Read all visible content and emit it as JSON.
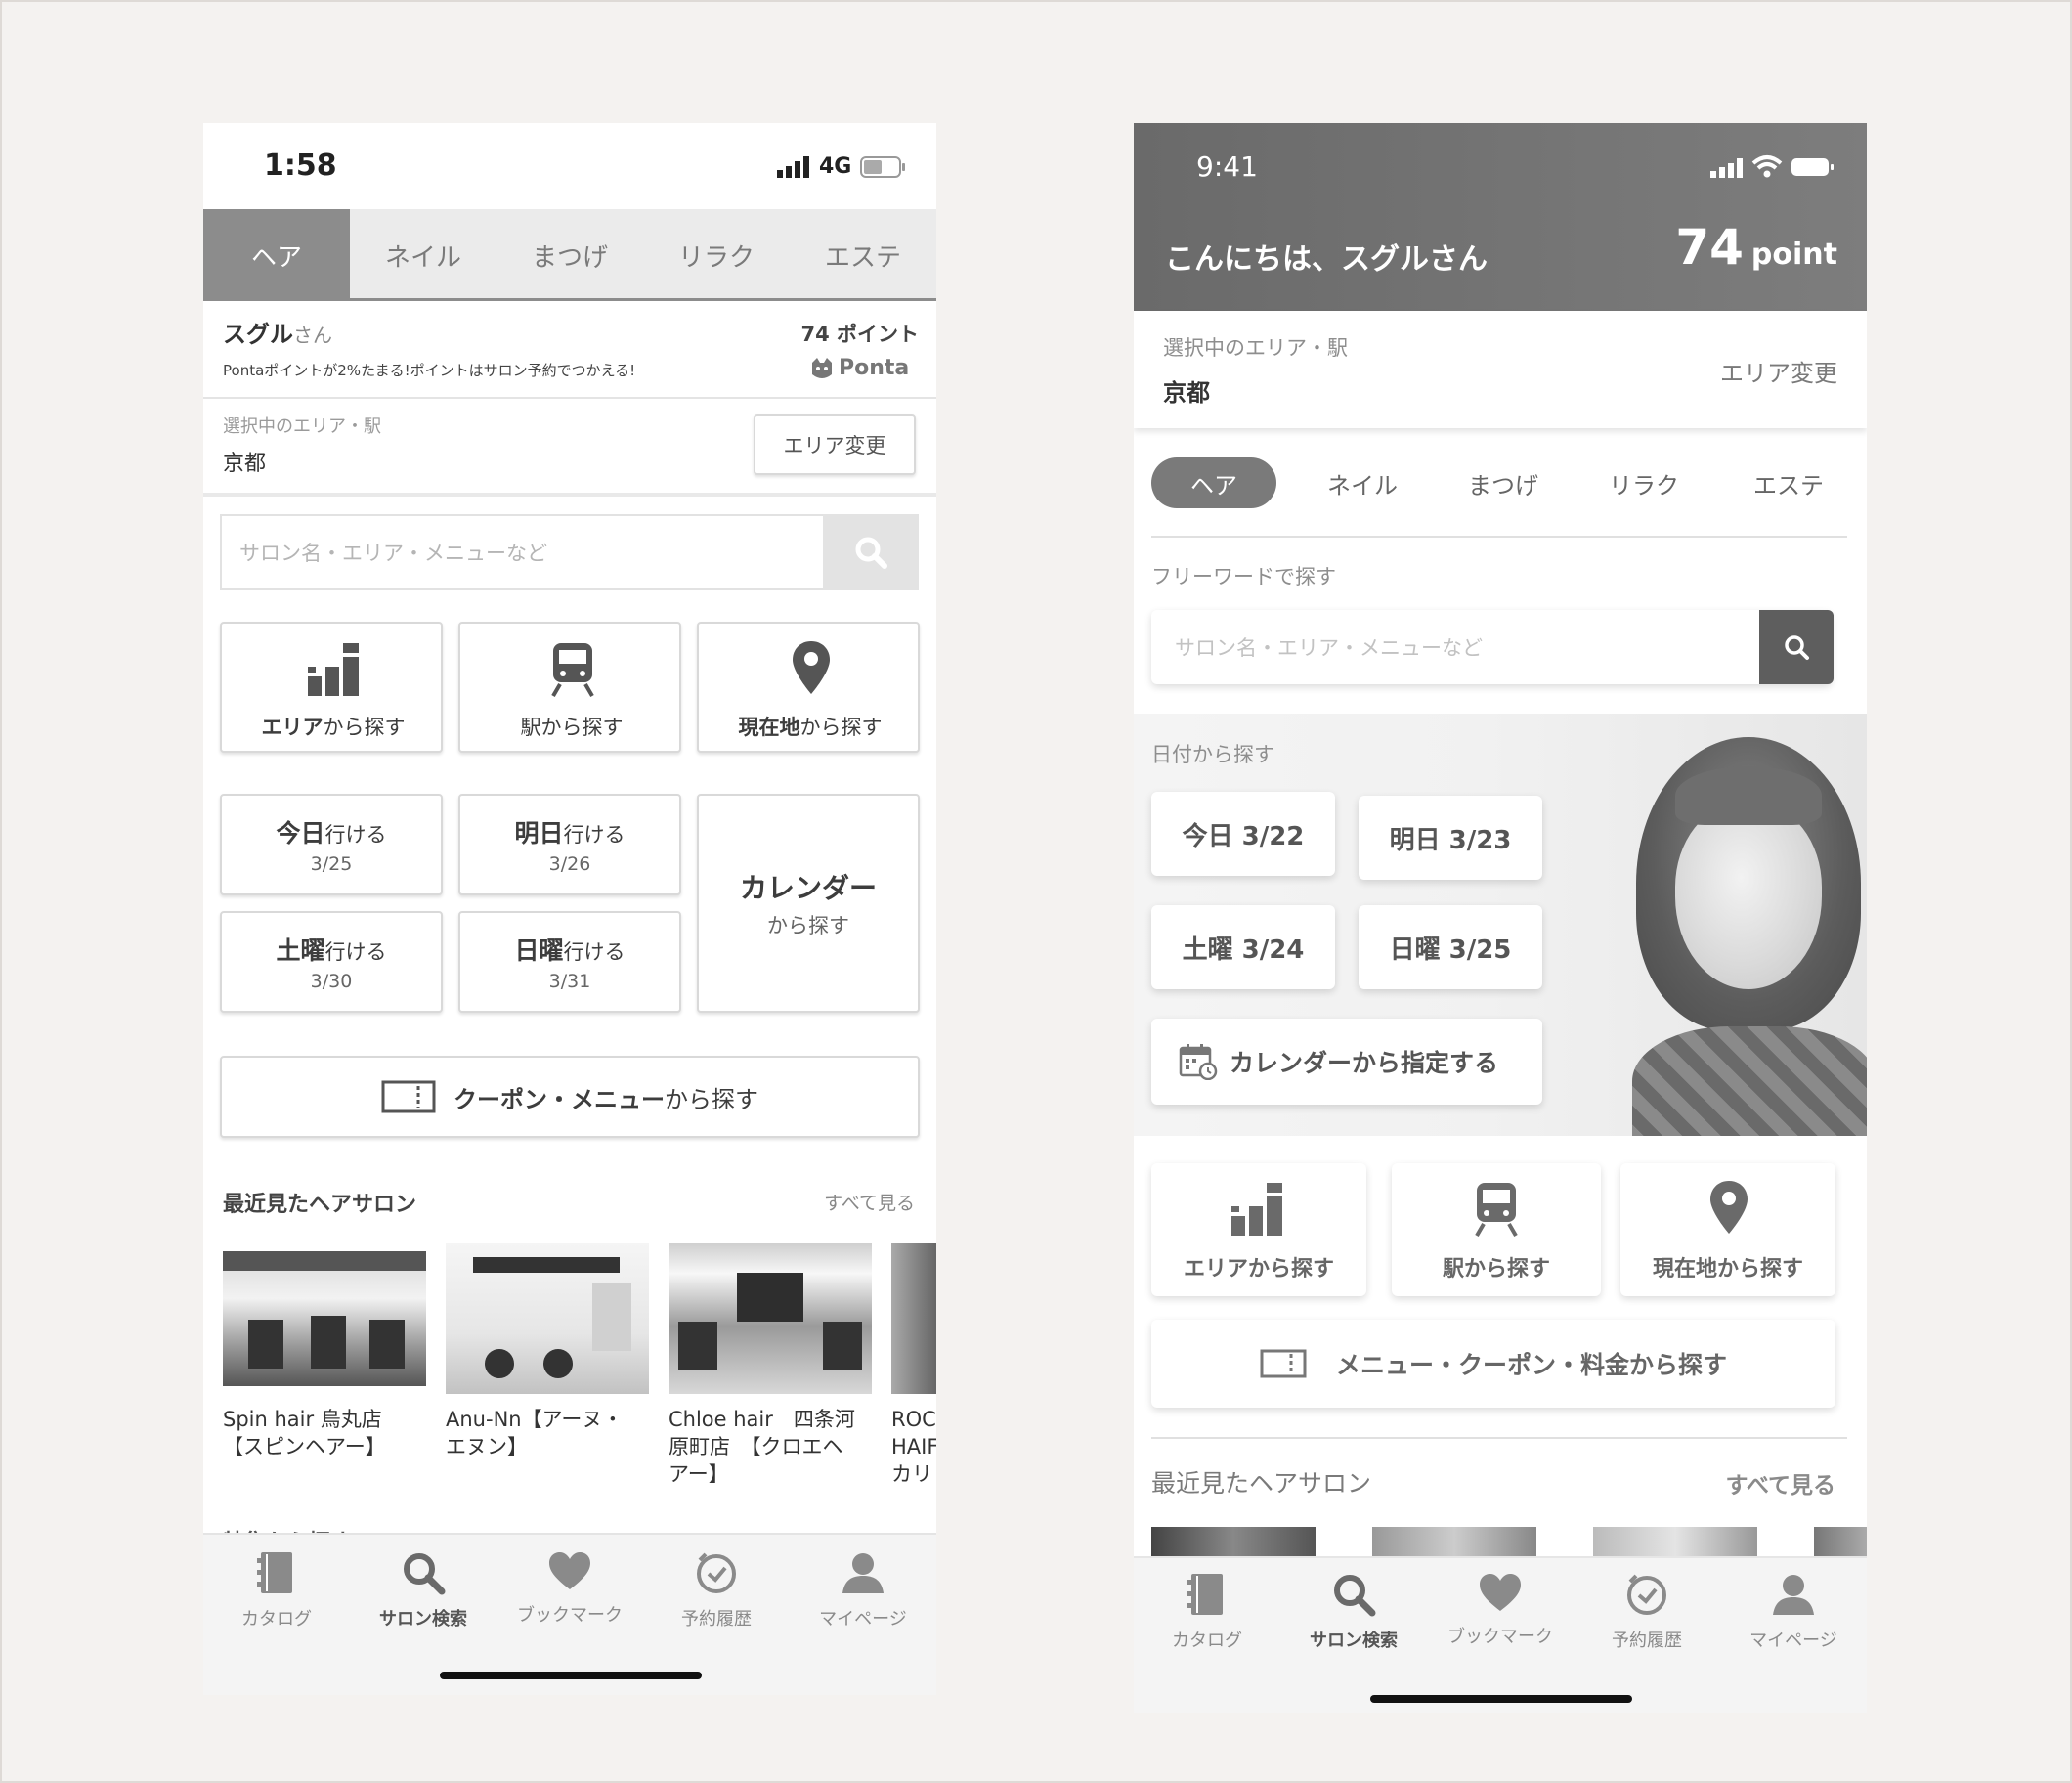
{
  "left": {
    "status": {
      "time": "1:58",
      "network": "4G"
    },
    "tabs": [
      "ヘア",
      "ネイル",
      "まつげ",
      "リラク",
      "エステ"
    ],
    "user": {
      "name": "スグル",
      "suffix": "さん",
      "points": "74 ポイント",
      "promo": "Pontaポイントが2%たまる!ポイントはサロン予約でつかえる!",
      "ponta": "Ponta"
    },
    "area": {
      "label": "選択中のエリア・駅",
      "value": "京都",
      "change_button": "エリア変更"
    },
    "search": {
      "placeholder": "サロン名・エリア・メニューなど"
    },
    "finders": [
      {
        "bold": "エリア",
        "rest": "から探す",
        "icon": "area-map-icon"
      },
      {
        "bold": "",
        "rest": "駅から探す",
        "icon": "train-icon"
      },
      {
        "bold": "現在地",
        "rest": "から探す",
        "icon": "location-pin-icon"
      }
    ],
    "dates": [
      {
        "day": "今日",
        "suffix": "行ける",
        "date": "3/25"
      },
      {
        "day": "明日",
        "suffix": "行ける",
        "date": "3/26"
      },
      {
        "day": "土曜",
        "suffix": "行ける",
        "date": "3/30"
      },
      {
        "day": "日曜",
        "suffix": "行ける",
        "date": "3/31"
      }
    ],
    "calendar": {
      "title": "カレンダー",
      "sub": "から探す"
    },
    "coupon": {
      "bold": "クーポン・メニュー",
      "rest": "から探す"
    },
    "recent": {
      "title": "最近見たヘアサロン",
      "see_all": "すべて見る"
    },
    "salons": [
      {
        "lines": [
          "Spin hair 烏丸店",
          "【スピンヘアー】"
        ]
      },
      {
        "lines": [
          "Anu-Nn【アーヌ・",
          "エヌン】"
        ]
      },
      {
        "lines": [
          "Chloe hair　四条河",
          "原町店　【クロエヘ",
          "アー】"
        ]
      },
      {
        "lines": [
          "ROC",
          "HAIF",
          "カリ"
        ]
      }
    ],
    "next_section_peek": "特集から探す"
  },
  "right": {
    "status": {
      "time": "9:41"
    },
    "greeting": "こんにちは、スグルさん",
    "points": {
      "value": "74",
      "unit": "point"
    },
    "area": {
      "label": "選択中のエリア・駅",
      "value": "京都",
      "change_button": "エリア変更"
    },
    "tabs": [
      "ヘア",
      "ネイル",
      "まつげ",
      "リラク",
      "エステ"
    ],
    "freeword": {
      "label": "フリーワードで探す",
      "placeholder": "サロン名・エリア・メニューなど"
    },
    "date_section": {
      "label": "日付から探す",
      "dates": [
        "今日 3/22",
        "明日 3/23",
        "土曜 3/24",
        "日曜 3/25"
      ],
      "calendar_button": "カレンダーから指定する"
    },
    "finders": [
      "エリアから探す",
      "駅から探す",
      "現在地から探す"
    ],
    "menu_button": "メニュー・クーポン・料金から探す",
    "recent": {
      "title": "最近見たヘアサロン",
      "see_all": "すべて見る"
    }
  },
  "bottom_nav": [
    "カタログ",
    "サロン検索",
    "ブックマーク",
    "予約履歴",
    "マイページ"
  ],
  "colors": {
    "tab_active": "#8c8c8c",
    "header_dark": "#6f6f6f",
    "search_btn": "#5e5e5e",
    "background": "#f4f2f0"
  }
}
